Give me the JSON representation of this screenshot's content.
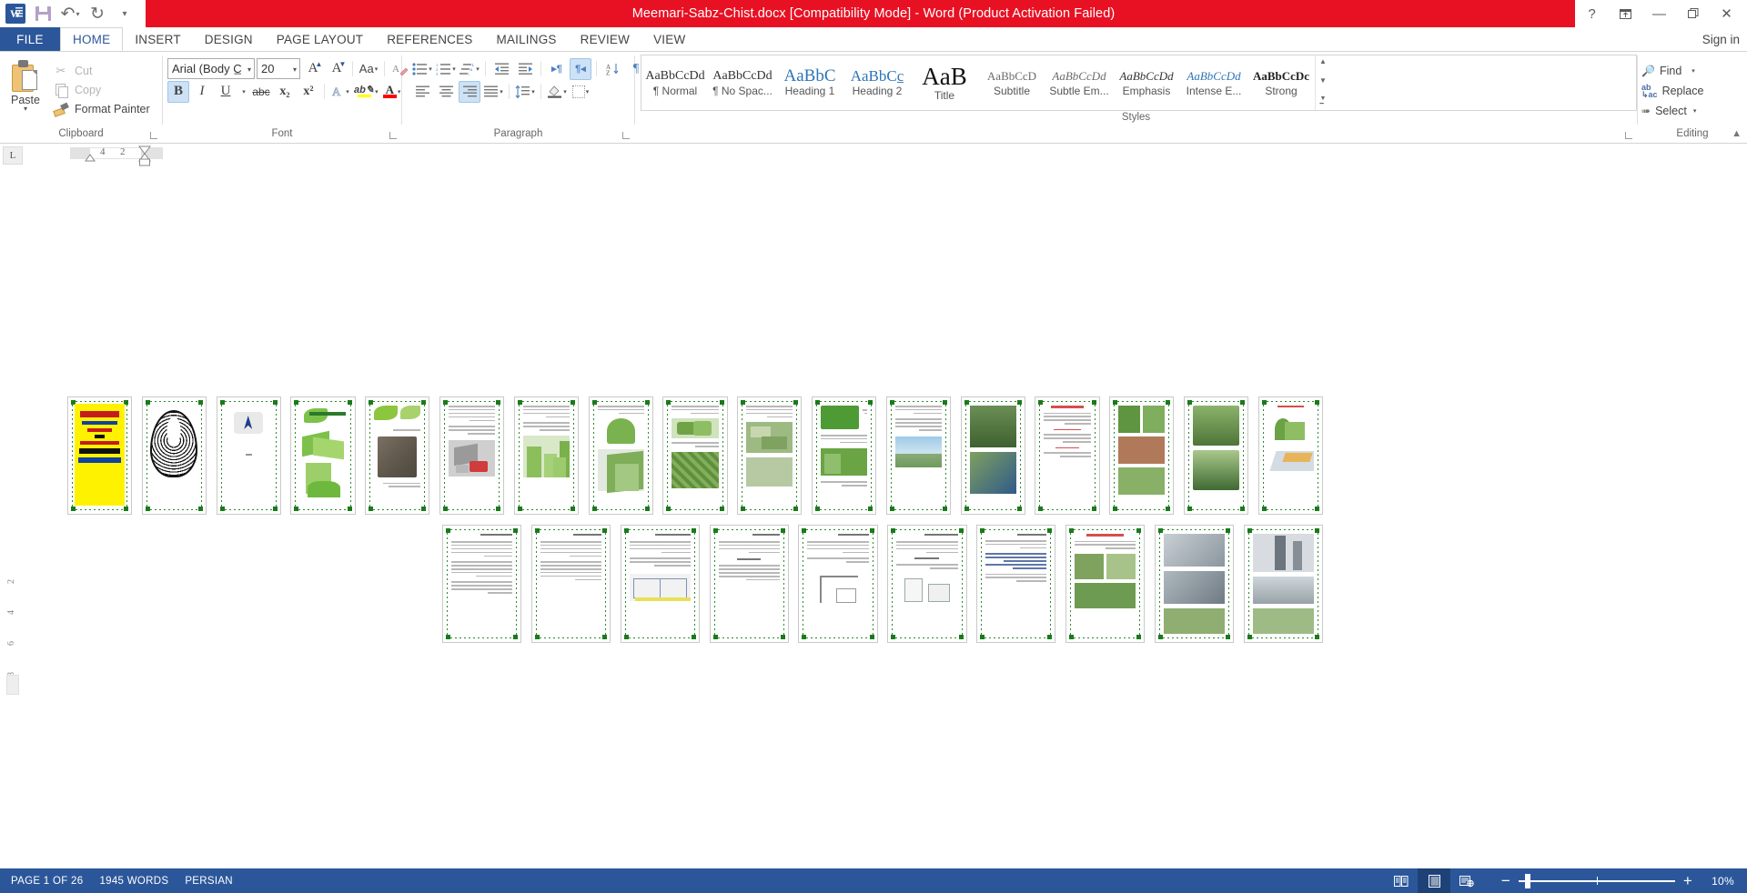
{
  "titlebar": {
    "document_title": "Meemari-Sabz-Chist.docx [Compatibility Mode]  -  Word (Product Activation Failed)",
    "quick_access": [
      {
        "name": "save",
        "icon": "save-icon"
      },
      {
        "name": "undo",
        "icon": "undo-icon"
      },
      {
        "name": "redo",
        "icon": "redo-icon"
      },
      {
        "name": "customize",
        "icon": "chevron-down-icon"
      }
    ],
    "window_controls": {
      "help": "?",
      "ribbon_display": "ribbon-display-options-icon",
      "minimize": "—",
      "restore": "❐",
      "close": "✕"
    }
  },
  "tabs": {
    "file": "FILE",
    "items": [
      "HOME",
      "INSERT",
      "DESIGN",
      "PAGE LAYOUT",
      "REFERENCES",
      "MAILINGS",
      "REVIEW",
      "VIEW"
    ],
    "active": "HOME",
    "sign_in": "Sign in"
  },
  "ribbon": {
    "clipboard": {
      "label": "Clipboard",
      "paste": "Paste",
      "cut": "Cut",
      "copy": "Copy",
      "format_painter": "Format Painter"
    },
    "font": {
      "label": "Font",
      "font_name": "Arial (Body C̲",
      "font_size": "20",
      "grow_font": "A",
      "shrink_font": "A",
      "change_case": "Aa",
      "clear_formatting": "clear-formatting-icon",
      "bold": "B",
      "italic": "I",
      "underline": "U",
      "strikethrough": "abc",
      "subscript": "x₂",
      "superscript": "x²",
      "text_effects": "A",
      "highlight_color": "ab",
      "font_color": "A",
      "highlight_swatch": "#FFFF00",
      "font_color_swatch": "#FF0000",
      "bold_active": true
    },
    "paragraph": {
      "label": "Paragraph",
      "bullets": "bullets-icon",
      "numbering": "numbering-icon",
      "multilevel": "multilevel-list-icon",
      "decrease_indent": "decrease-indent-icon",
      "increase_indent": "increase-indent-icon",
      "ltr": "▸¶",
      "rtl": "¶◂",
      "sort": "A↓",
      "show_marks": "¶",
      "align_left": "align-left-icon",
      "align_center": "align-center-icon",
      "align_right": "align-right-icon",
      "justify": "justify-icon",
      "line_spacing": "line-spacing-icon",
      "shading": "shading-icon",
      "borders": "borders-icon",
      "align_right_active": true,
      "rtl_active": true
    },
    "styles": {
      "label": "Styles",
      "items": [
        {
          "preview": "AaBbCcDd",
          "name": "¶ Normal",
          "style": "normal"
        },
        {
          "preview": "AaBbCcDd",
          "name": "¶ No Spac...",
          "style": "normal"
        },
        {
          "preview": "AaBbC",
          "name": "Heading 1",
          "style": "h1"
        },
        {
          "preview": "AaBbCc̲",
          "name": "Heading 2",
          "style": "h2"
        },
        {
          "preview": "AaB",
          "name": "Title",
          "style": "title"
        },
        {
          "preview": "AaBbCcD",
          "name": "Subtitle",
          "style": "subtitle"
        },
        {
          "preview": "AaBbCcDd",
          "name": "Subtle Em...",
          "style": "subtle-em"
        },
        {
          "preview": "AaBbCcDd",
          "name": "Emphasis",
          "style": "emphasis"
        },
        {
          "preview": "AaBbCcDd",
          "name": "Intense E...",
          "style": "intense-em"
        },
        {
          "preview": "AaBbCcDc",
          "name": "Strong",
          "style": "strong"
        }
      ],
      "scroll_up": "▲",
      "scroll_down": "▼",
      "more": "▬"
    },
    "editing": {
      "label": "Editing",
      "find": "Find",
      "replace": "Replace",
      "select": "Select"
    },
    "collapse": "collapse-ribbon-icon"
  },
  "ruler": {
    "tab_selector": "L",
    "marks": [
      "4",
      "2"
    ]
  },
  "document": {
    "zoom_view": "multi-page thumbnails",
    "row1": [
      {
        "id": "page-1",
        "kind": "cover-yellow"
      },
      {
        "id": "page-2",
        "kind": "calligraphy"
      },
      {
        "id": "page-3",
        "kind": "blue-logo"
      },
      {
        "id": "page-4",
        "kind": "green-arch-title"
      },
      {
        "id": "page-5",
        "kind": "leaf-text"
      },
      {
        "id": "page-6",
        "kind": "text-photo-red"
      },
      {
        "id": "page-7",
        "kind": "green-building"
      },
      {
        "id": "page-8",
        "kind": "green-tower"
      },
      {
        "id": "page-9",
        "kind": "garden-aerial"
      },
      {
        "id": "page-10",
        "kind": "text-map"
      },
      {
        "id": "page-11",
        "kind": "green-sidebar"
      },
      {
        "id": "page-12",
        "kind": "photo-sky"
      },
      {
        "id": "page-13",
        "kind": "green-wall-photos"
      },
      {
        "id": "page-14",
        "kind": "red-heading-text"
      },
      {
        "id": "page-15",
        "kind": "roof-garden-photos"
      },
      {
        "id": "page-16",
        "kind": "green-roof-photos"
      },
      {
        "id": "page-17",
        "kind": "diagram-green"
      }
    ],
    "row2": [
      {
        "id": "page-18",
        "kind": "text-page"
      },
      {
        "id": "page-19",
        "kind": "text-page"
      },
      {
        "id": "page-20",
        "kind": "text-section"
      },
      {
        "id": "page-21",
        "kind": "text-diagram"
      },
      {
        "id": "page-22",
        "kind": "text-page"
      },
      {
        "id": "page-23",
        "kind": "text-sketch"
      },
      {
        "id": "page-24",
        "kind": "text-blue-diagram"
      },
      {
        "id": "page-25",
        "kind": "red-title-photos"
      },
      {
        "id": "page-26",
        "kind": "photo-collage"
      },
      {
        "id": "page-27",
        "kind": "tower-photos"
      }
    ]
  },
  "status": {
    "page": "PAGE 1 OF 26",
    "words": "1945 WORDS",
    "language": "PERSIAN",
    "views": [
      {
        "name": "read-mode",
        "icon": "read-mode-icon",
        "active": false
      },
      {
        "name": "print-layout",
        "icon": "print-layout-icon",
        "active": true
      },
      {
        "name": "web-layout",
        "icon": "web-layout-icon",
        "active": false
      }
    ],
    "zoom_out": "−",
    "zoom_in": "+",
    "zoom_value": "10%"
  },
  "colors": {
    "title_red": "#E81123",
    "word_blue": "#2B579A",
    "status_blue": "#2B579A",
    "accent_highlight": "#CEE2F5"
  }
}
